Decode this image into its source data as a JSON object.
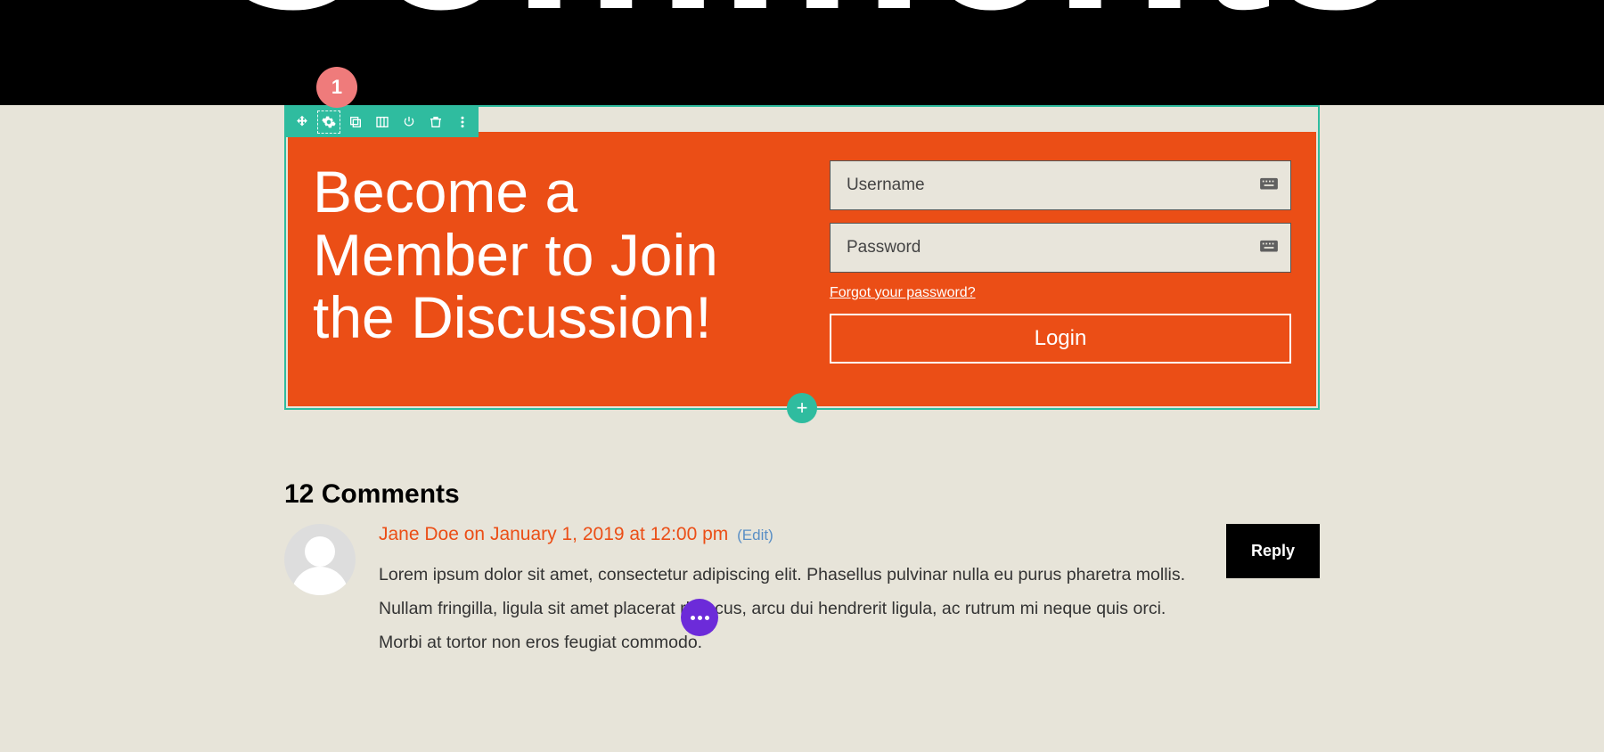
{
  "header": {
    "title": "Comments"
  },
  "badge": {
    "number": "1"
  },
  "toolbar": {
    "items": [
      "move",
      "settings",
      "duplicate",
      "columns",
      "power",
      "trash",
      "more"
    ]
  },
  "cta": {
    "heading": "Become a Member to Join the Discussion!",
    "username_placeholder": "Username",
    "password_placeholder": "Password",
    "forgot_label": "Forgot your password?",
    "login_label": "Login"
  },
  "add_button": "+",
  "comments": {
    "heading": "12 Comments",
    "list": [
      {
        "author": "Jane Doe",
        "date_prefix": " on ",
        "date": "January 1, 2019 at 12:00 pm",
        "edit_label": "(Edit)",
        "body": "Lorem ipsum dolor sit amet, consectetur adipiscing elit. Phasellus pulvinar nulla eu purus pharetra mollis. Nullam fringilla, ligula sit amet placerat rhoncus, arcu dui hendrerit ligula, ac rutrum mi neque quis orci. Morbi at tortor non eros feugiat commodo.",
        "reply_label": "Reply"
      }
    ]
  },
  "colors": {
    "accent_teal": "#2fbc9f",
    "accent_orange": "#eb4e16",
    "fab_purple": "#6c2bd9",
    "badge_pink": "#ef7b7b"
  }
}
